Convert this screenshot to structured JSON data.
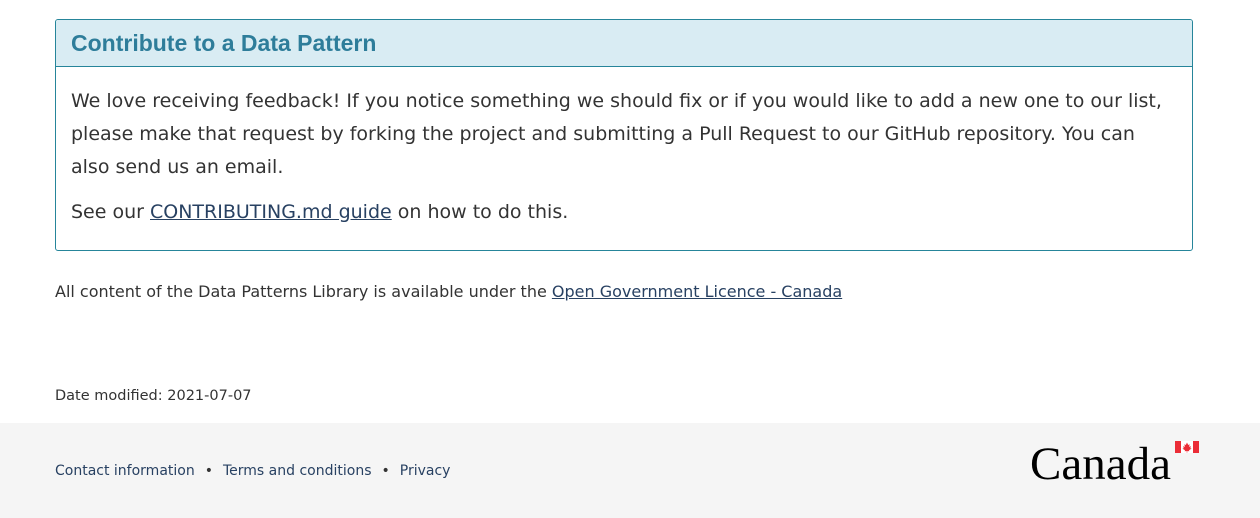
{
  "contribute": {
    "heading": "Contribute to a Data Pattern",
    "paragraph": "We love receiving feedback! If you notice something we should fix or if you would like to add a new one to our list, please make that request by forking the project and submitting a Pull Request to our GitHub repository. You can also send us an email.",
    "see_prefix": "See our ",
    "guide_link": "CONTRIBUTING.md guide",
    "see_suffix": " on how to do this."
  },
  "licence": {
    "text": "All content of the Data Patterns Library is available under the ",
    "link": "Open Government Licence - Canada"
  },
  "date_modified": {
    "label": "Date modified: ",
    "value": "2021-07-07"
  },
  "footer": {
    "links": [
      "Contact information",
      "Terms and conditions",
      "Privacy"
    ],
    "separator": "•",
    "wordmark": "Canada",
    "flag_color": "#eb2d37"
  }
}
